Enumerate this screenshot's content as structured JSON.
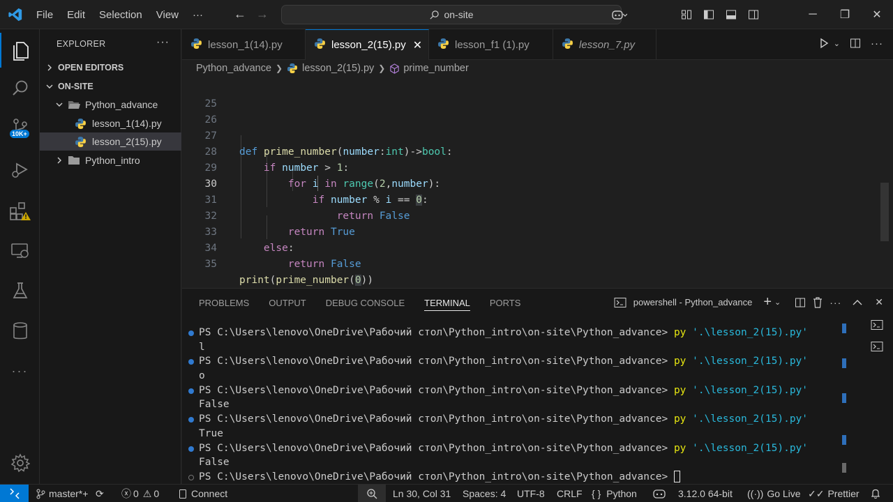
{
  "titlebar": {
    "menu": [
      "File",
      "Edit",
      "Selection",
      "View",
      "···"
    ],
    "search_text": "on-site"
  },
  "activitybar": {
    "source_control_badge": "10K+"
  },
  "sidebar": {
    "title": "EXPLORER",
    "more": "···",
    "items": [
      {
        "label": "OPEN EDITORS"
      },
      {
        "label": "ON-SITE"
      },
      {
        "label": "Python_advance"
      },
      {
        "label": "lesson_1(14).py"
      },
      {
        "label": "lesson_2(15).py"
      },
      {
        "label": "Python_intro"
      }
    ]
  },
  "tabs": [
    {
      "label": "lesson_1(14).py"
    },
    {
      "label": "lesson_2(15).py",
      "close": "✕"
    },
    {
      "label": "lesson_f1 (1).py"
    },
    {
      "label": "lesson_7.py"
    }
  ],
  "breadcrumb": {
    "folder": "Python_advance",
    "file": "lesson_2(15).py",
    "symbol": "prime_number"
  },
  "editor": {
    "line_numbers": [
      "25",
      "26",
      "27",
      "28",
      "29",
      "30",
      "31",
      "32",
      "33",
      "34",
      "35"
    ],
    "lines": {
      "l27": {
        "def": "def",
        "fn": "prime_number",
        "p1": "(",
        "arg": "number",
        "colon": ":",
        "type": "int",
        "p2": ")->",
        "ret": "bool",
        "end": ":"
      },
      "l28": {
        "if": "if",
        "var": "number",
        "op": " > ",
        "num": "1",
        "end": ":"
      },
      "l29": {
        "for": "for",
        "i": "i",
        "in": "in",
        "range": "range",
        "p1": "(",
        "num": "2",
        "comma": ",",
        "var": "number",
        "end": "):"
      },
      "l30": {
        "if": "if",
        "var": "number",
        "op": " % ",
        "i": "i",
        "eq": " == ",
        "num": "0",
        "end": ":"
      },
      "l31": {
        "ret": "return",
        "val": "False"
      },
      "l32": {
        "ret": "return",
        "val": "True"
      },
      "l33": {
        "else": "else",
        "end": ":"
      },
      "l34": {
        "ret": "return",
        "val": "False"
      },
      "l35": {
        "print": "print",
        "p1": "(",
        "fn": "prime_number",
        "p2": "(",
        "num": "0",
        "end": "))"
      }
    }
  },
  "panel": {
    "tabs": [
      "PROBLEMS",
      "OUTPUT",
      "DEBUG CONSOLE",
      "TERMINAL",
      "PORTS"
    ],
    "terminal_name": "powershell - Python_advance",
    "prompt": "PS C:\\Users\\lenovo\\OneDrive\\Рабочий стол\\Python_intro\\on-site\\Python_advance>",
    "cmd": "py",
    "arg": "'.\\lesson_2(15).py'",
    "outputs": [
      "l",
      "o",
      "False",
      "True",
      "False"
    ]
  },
  "statusbar": {
    "branch": "master*+",
    "errors": "0",
    "warnings": "0",
    "connect": "Connect",
    "position": "Ln 30, Col 31",
    "spaces": "Spaces: 4",
    "encoding": "UTF-8",
    "eol": "CRLF",
    "language": "Python",
    "interpreter": "3.12.0 64-bit",
    "golive": "Go Live",
    "prettier": "Prettier"
  }
}
